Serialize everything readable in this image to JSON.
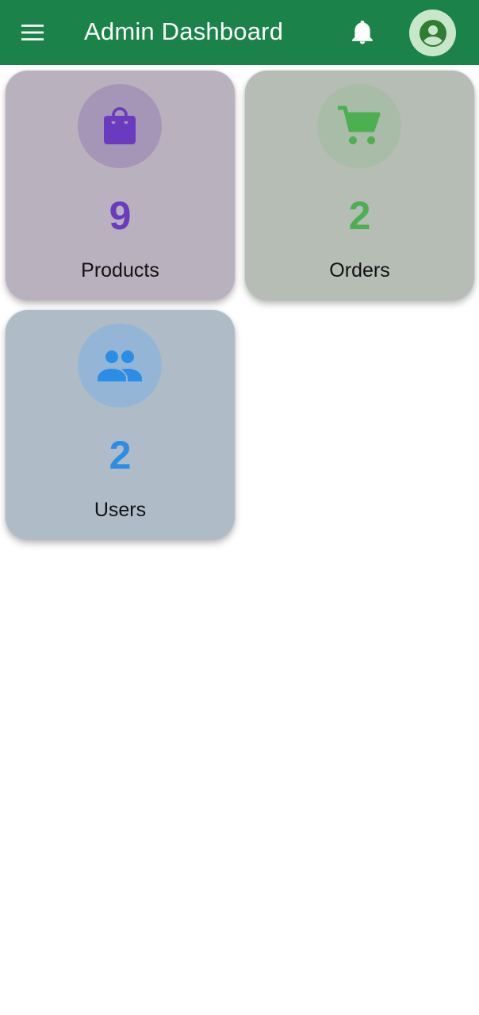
{
  "appbar": {
    "title": "Admin Dashboard",
    "menu_icon": "menu-icon",
    "notification_icon": "bell-icon",
    "avatar_icon": "account-circle-icon",
    "background": "#1b834a"
  },
  "cards": [
    {
      "id": "products",
      "count": "9",
      "label": "Products",
      "icon": "shopping-bag-icon",
      "accent": "#6a3bbe"
    },
    {
      "id": "orders",
      "count": "2",
      "label": "Orders",
      "icon": "shopping-cart-icon",
      "accent": "#4caf50"
    },
    {
      "id": "users",
      "count": "2",
      "label": "Users",
      "icon": "people-icon",
      "accent": "#2a8de6"
    }
  ]
}
